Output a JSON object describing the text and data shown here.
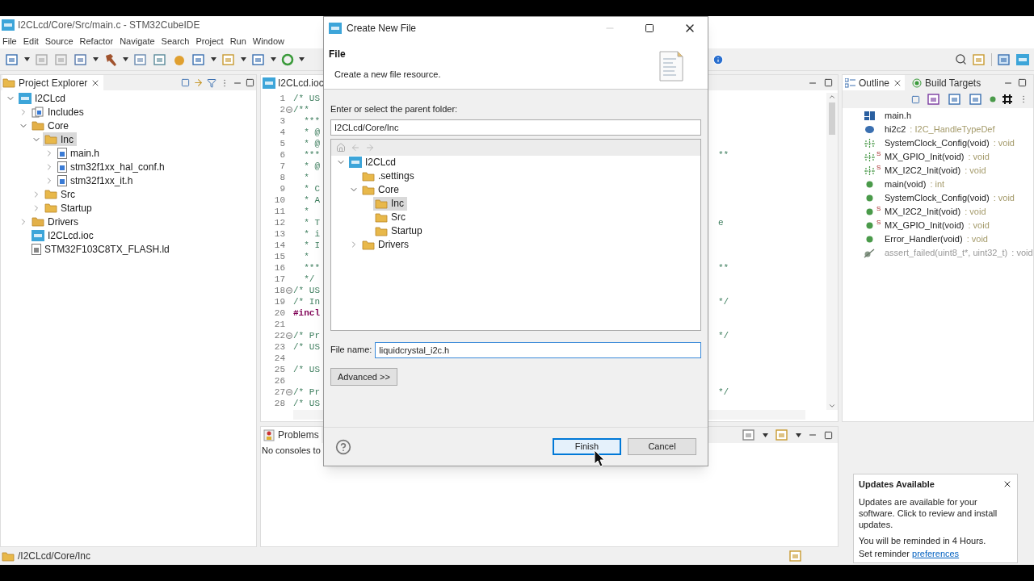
{
  "window": {
    "title": "I2CLcd/Core/Src/main.c - STM32CubeIDE"
  },
  "menu": [
    "File",
    "Edit",
    "Source",
    "Refactor",
    "Navigate",
    "Search",
    "Project",
    "Run",
    "Window"
  ],
  "project_explorer": {
    "title": "Project Explorer",
    "tree": [
      {
        "label": "I2CLcd",
        "kind": "project",
        "expanded": true,
        "selected": false,
        "children": [
          {
            "label": "Includes",
            "kind": "include",
            "expanded": false,
            "selected": false
          },
          {
            "label": "Core",
            "kind": "source-folder",
            "expanded": true,
            "selected": false,
            "children": [
              {
                "label": "Inc",
                "kind": "folder",
                "expanded": true,
                "selected": true,
                "children": [
                  {
                    "label": "main.h",
                    "kind": "header",
                    "expanded": false,
                    "selected": false
                  },
                  {
                    "label": "stm32f1xx_hal_conf.h",
                    "kind": "header",
                    "expanded": false,
                    "selected": false
                  },
                  {
                    "label": "stm32f1xx_it.h",
                    "kind": "header",
                    "expanded": false,
                    "selected": false
                  }
                ]
              },
              {
                "label": "Src",
                "kind": "folder",
                "expanded": false,
                "selected": false
              },
              {
                "label": "Startup",
                "kind": "folder",
                "expanded": false,
                "selected": false
              }
            ]
          },
          {
            "label": "Drivers",
            "kind": "source-folder",
            "expanded": false,
            "selected": false
          },
          {
            "label": "I2CLcd.ioc",
            "kind": "ioc",
            "selected": false
          },
          {
            "label": "STM32F103C8TX_FLASH.ld",
            "kind": "ld",
            "selected": false
          }
        ]
      }
    ]
  },
  "editor": {
    "tab": "I2CLcd.ioc",
    "lines": [
      {
        "number": "1",
        "text": "/* US",
        "kind": "comment"
      },
      {
        "number": "2",
        "text": "/**",
        "kind": "comment",
        "fold": true
      },
      {
        "number": "3",
        "text": "  ***",
        "kind": "comment"
      },
      {
        "number": "4",
        "text": "  * @",
        "kind": "comment"
      },
      {
        "number": "5",
        "text": "  * @",
        "kind": "comment"
      },
      {
        "number": "6",
        "text": "  ***",
        "kind": "comment",
        "tail": "**"
      },
      {
        "number": "7",
        "text": "  * @",
        "kind": "comment"
      },
      {
        "number": "8",
        "text": "  *",
        "kind": "comment"
      },
      {
        "number": "9",
        "text": "  * C",
        "kind": "comment"
      },
      {
        "number": "10",
        "text": "  * A",
        "kind": "comment"
      },
      {
        "number": "11",
        "text": "  *",
        "kind": "comment"
      },
      {
        "number": "12",
        "text": "  * T",
        "kind": "comment",
        "tail": "e"
      },
      {
        "number": "13",
        "text": "  * i",
        "kind": "comment"
      },
      {
        "number": "14",
        "text": "  * I",
        "kind": "comment"
      },
      {
        "number": "15",
        "text": "  *",
        "kind": "comment"
      },
      {
        "number": "16",
        "text": "  ***",
        "kind": "comment",
        "tail": "**"
      },
      {
        "number": "17",
        "text": "  */",
        "kind": "comment"
      },
      {
        "number": "18",
        "text": "/* US",
        "kind": "comment",
        "fold": true
      },
      {
        "number": "19",
        "text": "/* In",
        "kind": "comment",
        "tail": "*/"
      },
      {
        "number": "20",
        "text": "#incl",
        "kind": "directive"
      },
      {
        "number": "21"
      },
      {
        "number": "22",
        "text": "/* Pr",
        "kind": "comment",
        "fold": true,
        "tail": "*/"
      },
      {
        "number": "23",
        "text": "/* US",
        "kind": "comment"
      },
      {
        "number": "24"
      },
      {
        "number": "25",
        "text": "/* US",
        "kind": "comment"
      },
      {
        "number": "26"
      },
      {
        "number": "27",
        "text": "/* Pr",
        "kind": "comment",
        "fold": true,
        "tail": "*/"
      },
      {
        "number": "28",
        "text": "/* US",
        "kind": "comment"
      }
    ]
  },
  "outline": {
    "tabs": [
      {
        "label": "Outline",
        "selected": true
      },
      {
        "label": "Build Targets",
        "selected": false
      }
    ],
    "items": [
      {
        "name": "main.h",
        "kind": "include"
      },
      {
        "name": "hi2c2",
        "type": " : I2C_HandleTypeDef",
        "kind": "field"
      },
      {
        "name": "SystemClock_Config(void)",
        "type": " : void",
        "kind": "prototype"
      },
      {
        "name": "MX_GPIO_Init(void)",
        "type": " : void",
        "kind": "prototype",
        "marker": "S"
      },
      {
        "name": "MX_I2C2_Init(void)",
        "type": " : void",
        "kind": "prototype",
        "marker": "S"
      },
      {
        "name": "main(void)",
        "type": " : int",
        "kind": "function"
      },
      {
        "name": "SystemClock_Config(void)",
        "type": " : void",
        "kind": "function"
      },
      {
        "name": "MX_I2C2_Init(void)",
        "type": " : void",
        "kind": "function",
        "marker": "S"
      },
      {
        "name": "MX_GPIO_Init(void)",
        "type": " : void",
        "kind": "function",
        "marker": "S"
      },
      {
        "name": "Error_Handler(void)",
        "type": " : void",
        "kind": "function"
      },
      {
        "name": "assert_failed(uint8_t*, uint32_t)",
        "type": " : void",
        "kind": "inactive"
      }
    ]
  },
  "console": {
    "tab": "Problems",
    "message": "No consoles to"
  },
  "status_bar": {
    "path": "/I2CLcd/Core/Inc"
  },
  "dialog": {
    "title": "Create New File",
    "heading": "File",
    "description": "Create a new file resource.",
    "folder_label": "Enter or select the parent folder:",
    "folder_value": "I2CLcd/Core/Inc",
    "tree": [
      {
        "label": "I2CLcd",
        "kind": "project",
        "expanded": true,
        "selected": false,
        "children": [
          {
            "label": ".settings",
            "kind": "folder",
            "selected": false
          },
          {
            "label": "Core",
            "kind": "folder",
            "expanded": true,
            "selected": false,
            "children": [
              {
                "label": "Inc",
                "kind": "folder",
                "selected": true
              },
              {
                "label": "Src",
                "kind": "folder",
                "selected": false
              },
              {
                "label": "Startup",
                "kind": "folder",
                "selected": false
              }
            ]
          },
          {
            "label": "Drivers",
            "kind": "folder",
            "expanded": false,
            "selected": false
          }
        ]
      }
    ],
    "file_name_label": "File name:",
    "file_name_value": "liquidcrystal_i2c.h",
    "advanced_button": "Advanced >>",
    "buttons": [
      {
        "label": "Finish",
        "focused": true
      },
      {
        "label": "Cancel",
        "focused": false
      }
    ]
  },
  "notification": {
    "title": "Updates Available",
    "message": "Updates are available for your software. Click to review and install updates.",
    "reminder": "You will be reminded in 4 Hours.",
    "reminder_prefix": "Set reminder ",
    "reminder_link": "preferences"
  }
}
